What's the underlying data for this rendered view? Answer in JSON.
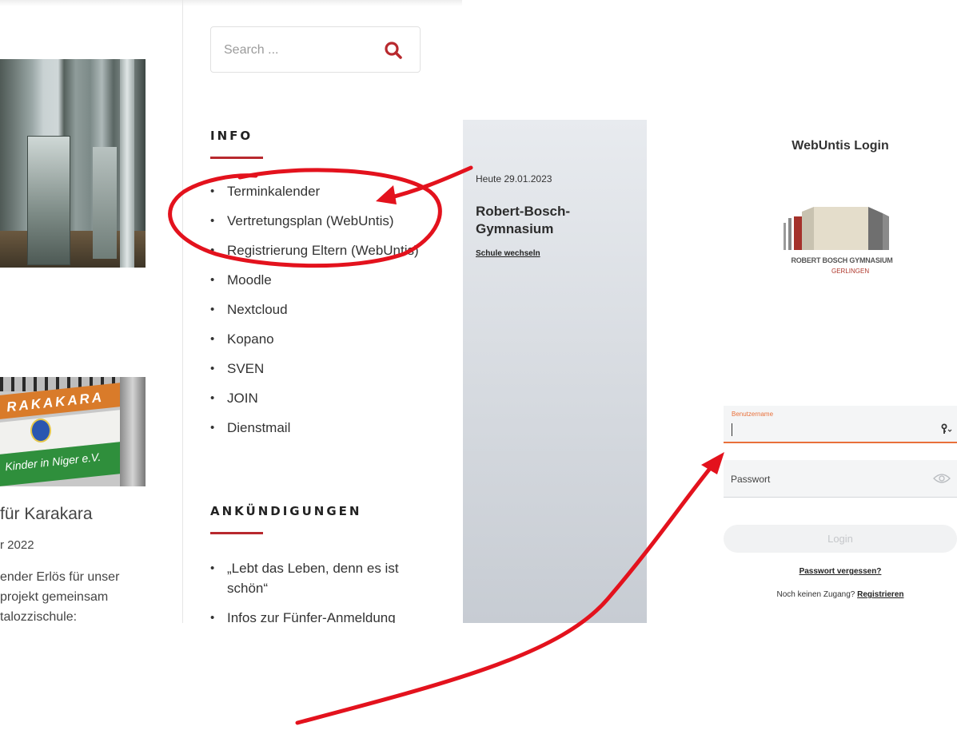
{
  "site": {
    "search": {
      "placeholder": "Search ..."
    },
    "info": {
      "title": "INFO",
      "items": [
        "Terminkalender",
        "Vertretungsplan (WebUntis)",
        "Registrierung Eltern (WebUntis)",
        "Moodle",
        "Nextcloud",
        "Kopano",
        "SVEN",
        "JOIN",
        "Dienstmail"
      ]
    },
    "announcements": {
      "title": "ANKÜNDIGUNGEN",
      "items": [
        "„Lebt das Leben, denn es ist schön“",
        "Infos zur Fünfer-Anmeldung"
      ]
    },
    "post": {
      "title": "für Karakara",
      "date": "r 2022",
      "excerpt": [
        "ender Erlös für unser",
        "projekt gemeinsam",
        "talozzischule:"
      ],
      "photo_text_top": "RAKAKARA",
      "photo_text_bottom": "Kinder in Niger e.V."
    }
  },
  "school": {
    "today": "Heute 29.01.2023",
    "name": "Robert-Bosch-Gymnasium",
    "switch_link": "Schule wechseln"
  },
  "login": {
    "title": "WebUntis Login",
    "logo_line1": "ROBERT BOSCH GYMNASIUM",
    "logo_line2": "GERLINGEN",
    "username_label": "Benutzername",
    "password_placeholder": "Passwort",
    "login_button": "Login",
    "forgot_link": "Passwort vergessen?",
    "no_access_text": "Noch keinen Zugang?",
    "register_link": "Registrieren"
  },
  "colors": {
    "accent_red": "#b8292e",
    "annotation_red": "#e3121d",
    "field_focus": "#e9703a"
  }
}
